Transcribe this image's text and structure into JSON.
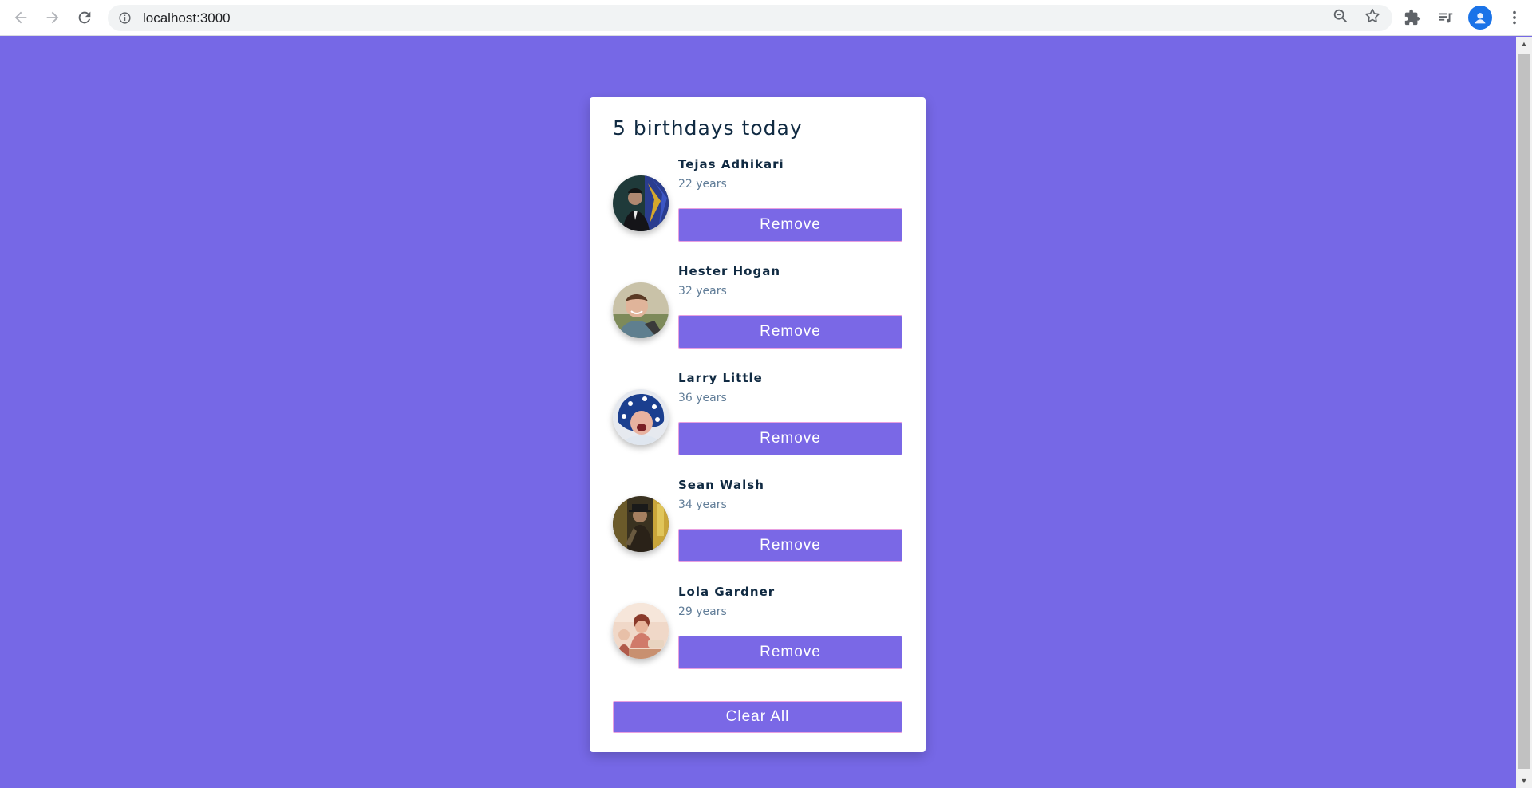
{
  "browser": {
    "url": "localhost:3000",
    "icons": [
      "back-icon",
      "forward-icon",
      "reload-icon",
      "info-icon",
      "zoom-icon",
      "star-icon",
      "extensions-icon",
      "media-icon",
      "profile-icon",
      "menu-icon"
    ]
  },
  "app": {
    "title": "5 birthdays today",
    "people": [
      {
        "name": "Tejas Adhikari",
        "age": "22 years",
        "remove_label": "Remove"
      },
      {
        "name": "Hester Hogan",
        "age": "32 years",
        "remove_label": "Remove"
      },
      {
        "name": "Larry Little",
        "age": "36 years",
        "remove_label": "Remove"
      },
      {
        "name": "Sean Walsh",
        "age": "34 years",
        "remove_label": "Remove"
      },
      {
        "name": "Lola Gardner",
        "age": "29 years",
        "remove_label": "Remove"
      }
    ],
    "clear_label": "Clear All"
  },
  "colors": {
    "background": "#7668e6",
    "button": "#7a68e6",
    "heading": "#102a42",
    "subtext": "#617d98"
  }
}
